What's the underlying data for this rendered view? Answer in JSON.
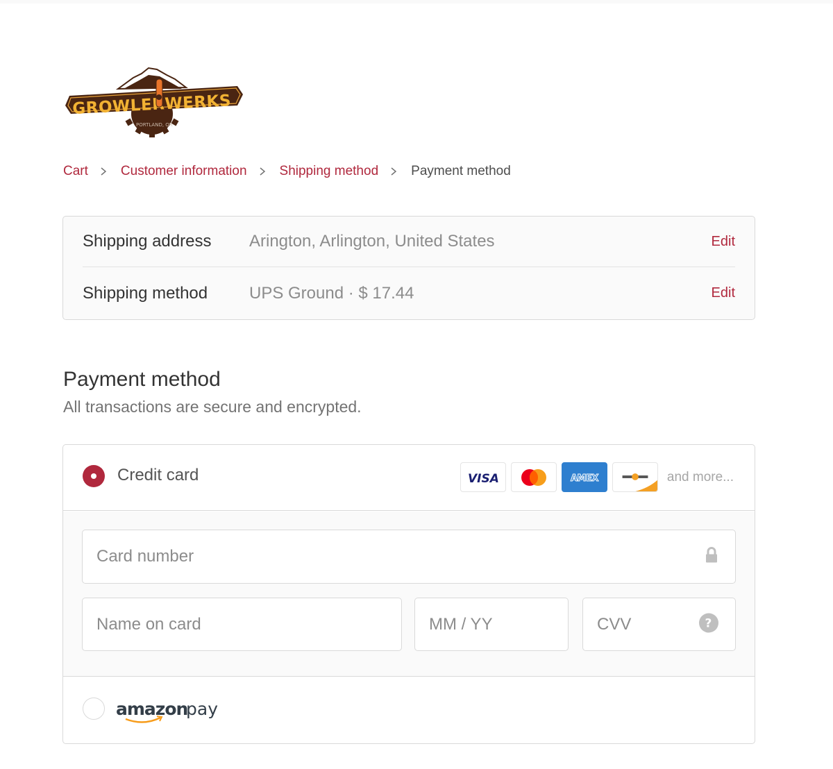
{
  "brand": {
    "name": "GROWLERWERKS",
    "tagline": "PORTLAND, OR",
    "colors": {
      "primary": "#b0283d",
      "logo_dark": "#4a2512",
      "logo_yellow": "#f2b233",
      "logo_orange": "#e8742a"
    }
  },
  "breadcrumb": {
    "items": [
      {
        "label": "Cart",
        "link": true
      },
      {
        "label": "Customer information",
        "link": true
      },
      {
        "label": "Shipping method",
        "link": true
      },
      {
        "label": "Payment method",
        "link": false
      }
    ]
  },
  "review": {
    "rows": [
      {
        "label": "Shipping address",
        "value": "Arington, Arlington, United States",
        "action": "Edit"
      },
      {
        "label": "Shipping method",
        "value": "UPS Ground · $ 17.44",
        "action": "Edit"
      }
    ]
  },
  "payment": {
    "title": "Payment method",
    "subtitle": "All transactions are secure and encrypted.",
    "options": [
      {
        "label": "Credit card",
        "selected": true
      },
      {
        "label": "amazon pay",
        "selected": false
      }
    ],
    "card_brands": [
      "VISA",
      "Mastercard",
      "AMEX",
      "Discover"
    ],
    "and_more": "and more...",
    "fields": {
      "card_number": {
        "placeholder": "Card number",
        "value": ""
      },
      "name_on_card": {
        "placeholder": "Name on card",
        "value": ""
      },
      "expiry": {
        "placeholder": "MM / YY",
        "value": ""
      },
      "cvv": {
        "placeholder": "CVV",
        "value": ""
      }
    },
    "amazon": {
      "word1": "amazon",
      "word2": "pay"
    }
  }
}
